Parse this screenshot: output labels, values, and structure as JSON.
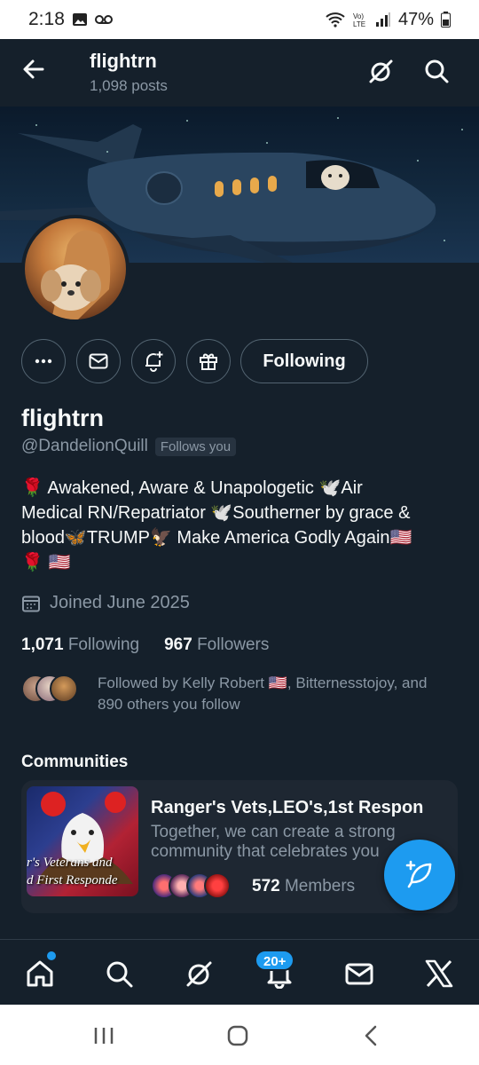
{
  "status_bar": {
    "time": "2:18",
    "battery": "47%"
  },
  "header": {
    "title": "flightrn",
    "post_count": "1,098 posts"
  },
  "actions": {
    "following_label": "Following"
  },
  "profile": {
    "name": "flightrn",
    "handle": "@DandelionQuill",
    "follows_you": "Follows you",
    "bio_line1": "🌹 Awakened, Aware & Unapologetic 🕊️Air",
    "bio_line2": "Medical RN/Repatriator 🕊️Southerner by grace &",
    "bio_line3": "blood🦋TRUMP🦅 Make America Godly Again🇺🇸",
    "bio_line4": "🌹 🇺🇸",
    "joined": "Joined June 2025",
    "following_count": "1,071",
    "following_label": "Following",
    "followers_count": "967",
    "followers_label": "Followers",
    "followed_by": "Followed by Kelly Robert 🇺🇸, Bitternesstojoy, and 890 others you follow"
  },
  "communities": {
    "label": "Communities",
    "card": {
      "name": "Ranger's Vets,LEO's,1st Respon",
      "description": "Together, we can create a strong community that celebrates you",
      "image_text_line1": "r's Veterans and",
      "image_text_line2": "d First Responde",
      "members_count": "572",
      "members_label": "Members"
    }
  },
  "bottom_nav": {
    "notifications_badge": "20+"
  },
  "colors": {
    "background": "#15202b",
    "accent": "#1d9bf0",
    "muted": "#8b98a5"
  },
  "icons": [
    "back-arrow-icon",
    "grok-icon",
    "search-icon",
    "more-icon",
    "mail-icon",
    "bell-plus-icon",
    "gift-icon",
    "calendar-icon",
    "compose-feather-icon",
    "home-icon",
    "x-logo-icon"
  ]
}
